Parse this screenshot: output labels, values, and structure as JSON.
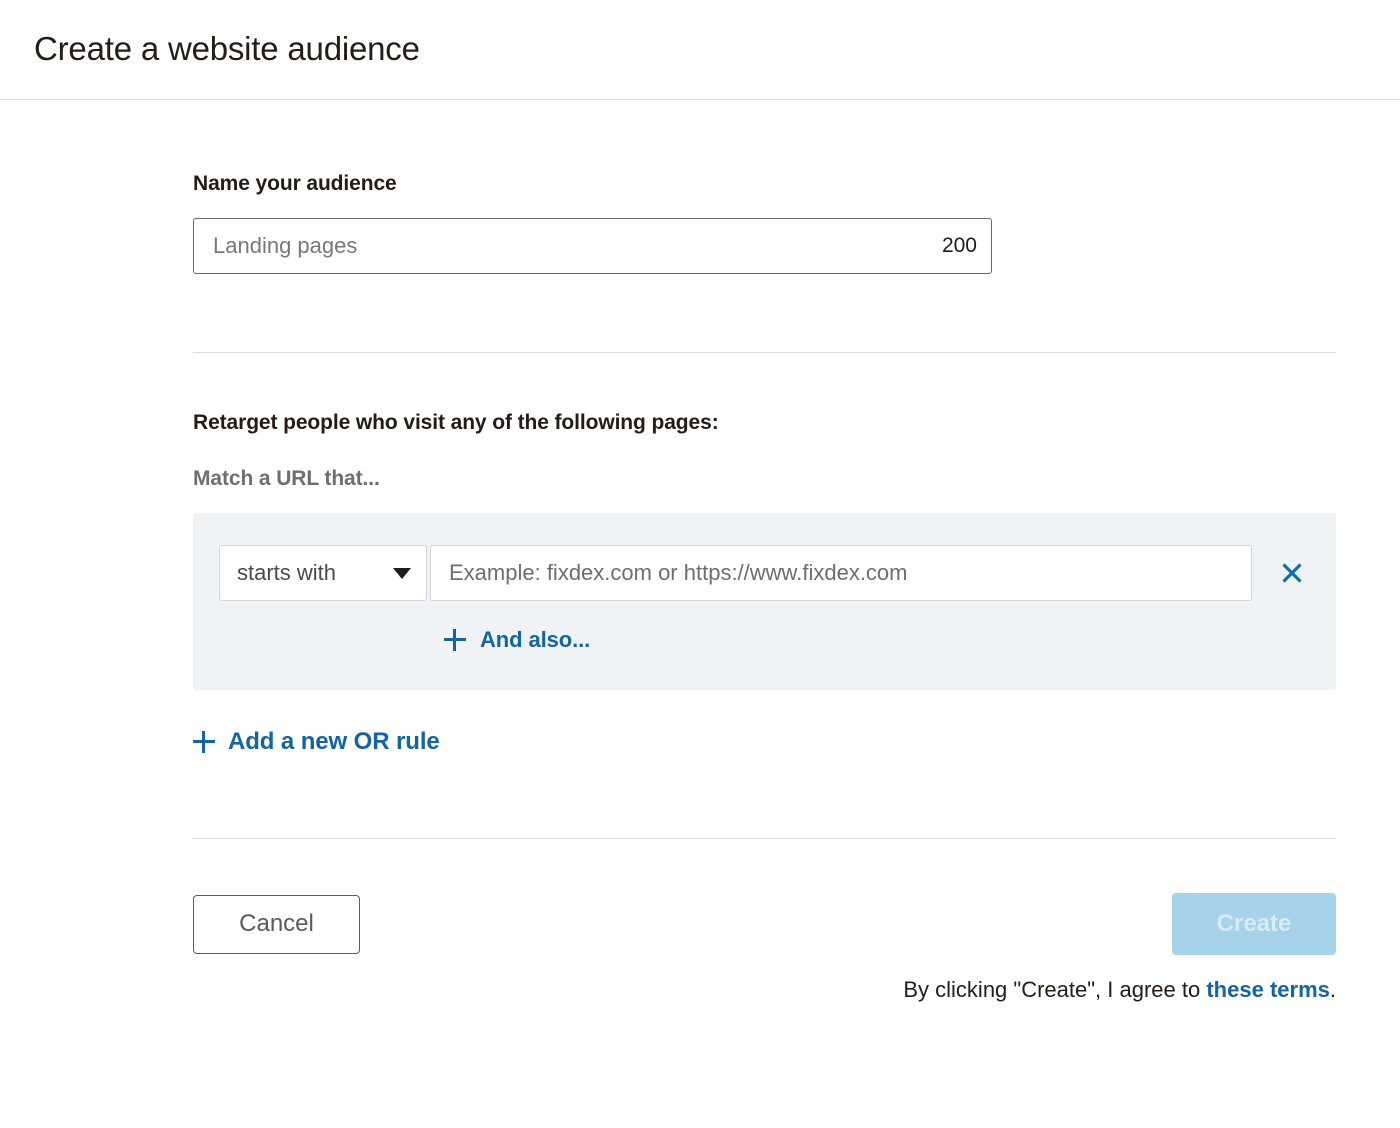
{
  "header": {
    "title": "Create a website audience"
  },
  "name_section": {
    "label": "Name your audience",
    "input_value": "",
    "input_placeholder": "Landing pages",
    "char_counter": "200"
  },
  "retarget_section": {
    "heading": "Retarget people who visit any of the following pages:",
    "match_label": "Match a URL that...",
    "rule": {
      "match_type": "starts with",
      "match_type_options": [
        "starts with"
      ],
      "url_value": "",
      "url_placeholder": "Example: fixdex.com or https://www.fixdex.com",
      "remove_icon": "close-icon"
    },
    "and_also": {
      "icon": "plus-icon",
      "label": "And also..."
    },
    "or_rule": {
      "icon": "plus-icon",
      "label": "Add a new OR rule"
    }
  },
  "footer": {
    "cancel_label": "Cancel",
    "create_label": "Create",
    "terms_prefix": "By clicking \"Create\", I agree to ",
    "terms_link": "these terms",
    "terms_suffix": "."
  },
  "colors": {
    "accent_blue": "#1364a0",
    "panel_bg": "#eff3f6",
    "create_disabled_bg": "#a6d2ea",
    "divider": "#dcdcdc",
    "text": "#241c15",
    "muted_text": "#6e6e6e"
  }
}
